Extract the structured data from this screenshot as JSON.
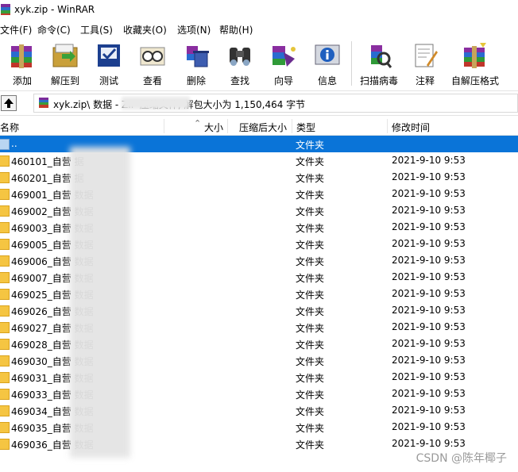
{
  "window": {
    "title": "xyk.zip - WinRAR"
  },
  "menu": [
    "文件(F)",
    "命令(C)",
    "工具(S)",
    "收藏夹(O)",
    "选项(N)",
    "帮助(H)"
  ],
  "toolbar": [
    {
      "label": "添加",
      "icon": "add-archive-icon"
    },
    {
      "label": "解压到",
      "icon": "extract-to-icon"
    },
    {
      "label": "测试",
      "icon": "test-icon"
    },
    {
      "label": "查看",
      "icon": "view-icon"
    },
    {
      "label": "删除",
      "icon": "delete-icon"
    },
    {
      "label": "查找",
      "icon": "find-binoculars-icon"
    },
    {
      "label": "向导",
      "icon": "wizard-icon"
    },
    {
      "label": "信息",
      "icon": "info-icon"
    },
    {
      "label": "扫描病毒",
      "icon": "scan-virus-icon"
    },
    {
      "label": "注释",
      "icon": "comment-icon"
    },
    {
      "label": "自解压格式",
      "icon": "sfx-icon"
    }
  ],
  "path": {
    "text": "xyk.zip\\                          数据 - ZIP 压缩文件, 解包大小为 1,150,464 字节"
  },
  "columns": [
    "名称",
    "大小",
    "压缩后大小",
    "类型",
    "修改时间"
  ],
  "rows": [
    {
      "name": "..",
      "type": "文件夹",
      "modified": ""
    },
    {
      "name": "460101_自营                    据",
      "type": "文件夹",
      "modified": "2021-9-10 9:53"
    },
    {
      "name": "460201_自营                    据",
      "type": "文件夹",
      "modified": "2021-9-10 9:53"
    },
    {
      "name": "469001_自营                  数据",
      "type": "文件夹",
      "modified": "2021-9-10 9:53"
    },
    {
      "name": "469002_自营                  数据",
      "type": "文件夹",
      "modified": "2021-9-10 9:53"
    },
    {
      "name": "469003_自营                  数据",
      "type": "文件夹",
      "modified": "2021-9-10 9:53"
    },
    {
      "name": "469005_自营                  数据",
      "type": "文件夹",
      "modified": "2021-9-10 9:53"
    },
    {
      "name": "469006_自营                  数据",
      "type": "文件夹",
      "modified": "2021-9-10 9:53"
    },
    {
      "name": "469007_自营                  数据",
      "type": "文件夹",
      "modified": "2021-9-10 9:53"
    },
    {
      "name": "469025_自营                  数据",
      "type": "文件夹",
      "modified": "2021-9-10 9:53"
    },
    {
      "name": "469026_自营                  数据",
      "type": "文件夹",
      "modified": "2021-9-10 9:53"
    },
    {
      "name": "469027_自营                  数据",
      "type": "文件夹",
      "modified": "2021-9-10 9:53"
    },
    {
      "name": "469028_自营                  数据",
      "type": "文件夹",
      "modified": "2021-9-10 9:53"
    },
    {
      "name": "469030_自营                  数据",
      "type": "文件夹",
      "modified": "2021-9-10 9:53"
    },
    {
      "name": "469031_自营                  数据",
      "type": "文件夹",
      "modified": "2021-9-10 9:53"
    },
    {
      "name": "469033_自营                  数据",
      "type": "文件夹",
      "modified": "2021-9-10 9:53"
    },
    {
      "name": "469034_自营                  数据",
      "type": "文件夹",
      "modified": "2021-9-10 9:53"
    },
    {
      "name": "469035_自营                  数据",
      "type": "文件夹",
      "modified": "2021-9-10 9:53"
    },
    {
      "name": "469036_自营                  数据",
      "type": "文件夹",
      "modified": "2021-9-10 9:53"
    }
  ],
  "watermark": "CSDN @陈年椰子",
  "colors": {
    "selection": "#0a74d8",
    "folder": "#f5c542"
  }
}
